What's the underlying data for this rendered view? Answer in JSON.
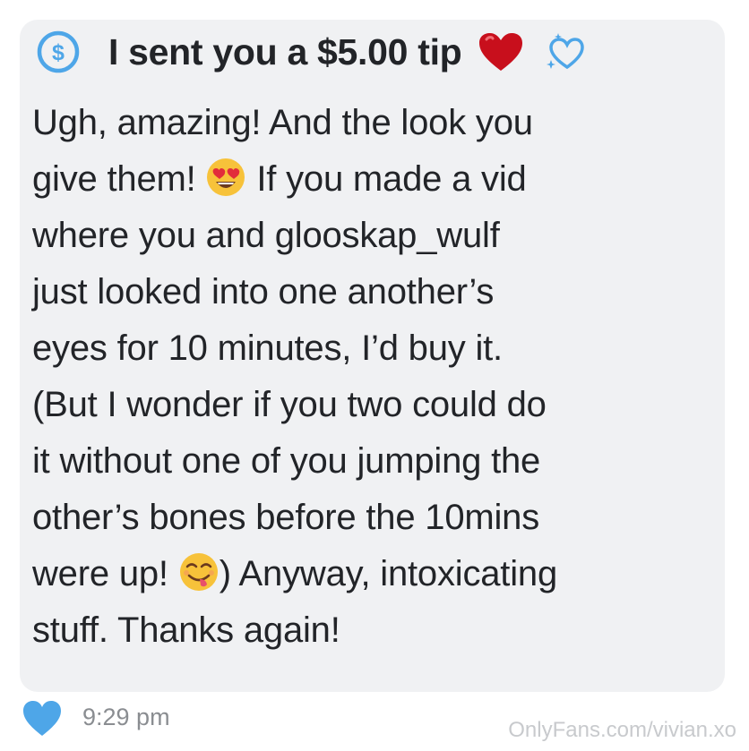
{
  "message": {
    "tip_text": "I sent you a $5.00 tip",
    "lines": [
      "Ugh, amazing! And the look you",
      {
        "before": "give them! ",
        "emoji": "heart-eyes-emoji",
        "after": " If you made a vid"
      },
      "where you and glooskap_wulf",
      "just looked into one another’s",
      "eyes for 10 minutes, I’d buy it.",
      "(But I wonder if you two could do",
      "it without one of you jumping the",
      "other’s bones before the 10mins",
      {
        "before": "were up! ",
        "emoji": "yum-face-emoji",
        "after": ") Anyway, intoxicating"
      },
      "stuff. Thanks again!"
    ]
  },
  "footer": {
    "timestamp": "9:29 pm",
    "watermark": "OnlyFans.com/vivian.xo"
  },
  "icons": {
    "tip": "dollar-circle-icon",
    "heart_red": "red-heart-icon",
    "heart_blue": "sparkling-blue-heart-icon",
    "like": "like-heart-icon"
  },
  "colors": {
    "bubble_bg": "#f0f1f3",
    "accent_blue": "#4ea6e8",
    "text": "#222428",
    "timestamp": "#8a8d91",
    "heart_red": "#d0101c"
  }
}
